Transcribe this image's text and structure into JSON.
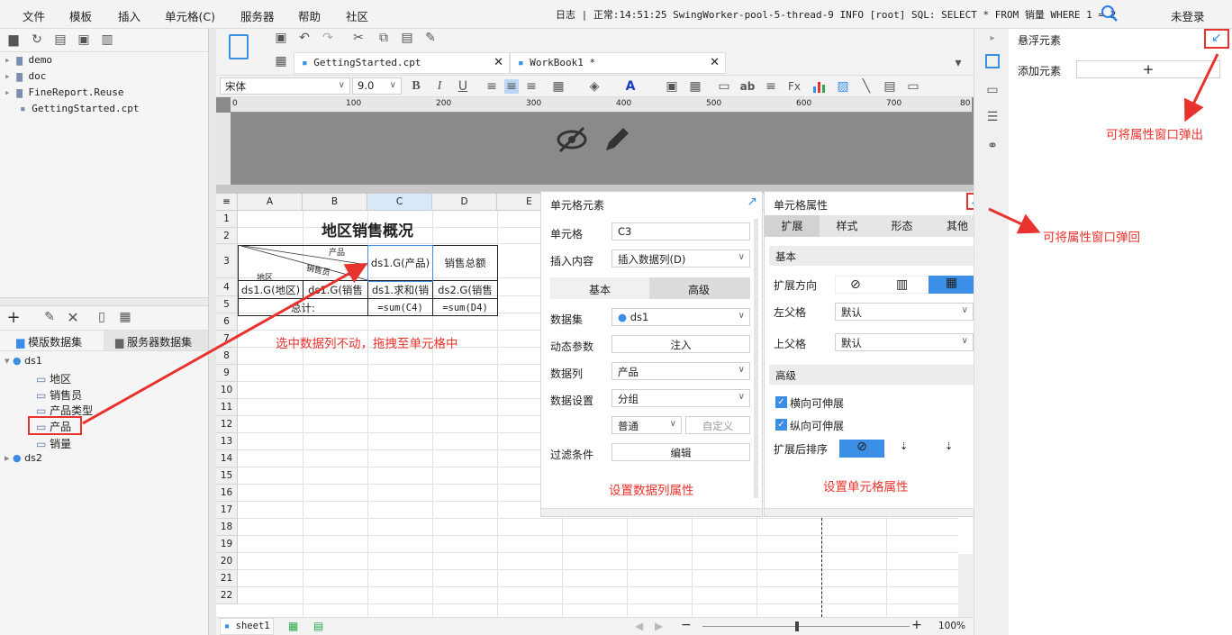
{
  "menu": [
    "文件",
    "模板",
    "插入",
    "单元格(C)",
    "服务器",
    "帮助",
    "社区"
  ],
  "log_text": "日志 | 正常:14:51:25 SwingWorker-pool-5-thread-9 INFO [root] SQL: SELECT * FROM 销量 WHERE 1 = 2",
  "login": "未登录",
  "file_tree": [
    "demo",
    "doc",
    "FineReport.Reuse",
    "GettingStarted.cpt"
  ],
  "dataset_tabs": {
    "template": "模版数据集",
    "server": "服务器数据集"
  },
  "datasets": {
    "ds1": "ds1",
    "ds1_fields": [
      "地区",
      "销售员",
      "产品类型",
      "产品",
      "销量"
    ],
    "ds2": "ds2"
  },
  "tabs": {
    "file1": "GettingStarted.cpt",
    "file2": "WorkBook1 *"
  },
  "format": {
    "font": "宋体",
    "size": "9.0"
  },
  "ruler_ticks": [
    "0",
    "100",
    "200",
    "300",
    "400",
    "500",
    "600",
    "700",
    "80"
  ],
  "columns": [
    "A",
    "B",
    "C",
    "D",
    "E"
  ],
  "rows": [
    "1",
    "2",
    "3",
    "4",
    "5",
    "6",
    "7",
    "8",
    "9",
    "10",
    "11",
    "12",
    "13",
    "14",
    "15",
    "16",
    "17",
    "18",
    "19",
    "20",
    "21",
    "22"
  ],
  "report": {
    "title": "地区销售概况",
    "diag_top": "产品",
    "diag_mid": "销售员",
    "diag_bottom": "地区",
    "c3": "ds1.G(产品)",
    "d3": "销售总额",
    "a4": "ds1.G(地区)",
    "b4": "ds1.G(销售",
    "c4": "ds1.求和(销",
    "d4": "ds2.G(销售",
    "a5": "总计:",
    "c5": "=sum(C4)",
    "d5": "=sum(D4)"
  },
  "annotations": {
    "drag": "选中数据列不动，拖拽至单元格中",
    "dataset_prop": "设置数据列属性",
    "cell_prop": "设置单元格属性",
    "popout": "可将属性窗口弹出",
    "popback": "可将属性窗口弹回"
  },
  "cell_element": {
    "title": "单元格元素",
    "cell_label": "单元格",
    "cell_value": "C3",
    "insert_label": "插入内容",
    "insert_value": "插入数据列(D)",
    "tab_basic": "基本",
    "tab_advanced": "高级",
    "dataset_label": "数据集",
    "dataset_value": "ds1",
    "param_label": "动态参数",
    "param_btn": "注入",
    "column_label": "数据列",
    "column_value": "产品",
    "setting_label": "数据设置",
    "setting_value": "分组",
    "mode_value": "普通",
    "custom_btn": "自定义",
    "filter_label": "过滤条件",
    "filter_btn": "编辑"
  },
  "cell_prop": {
    "title": "单元格属性",
    "tabs": [
      "扩展",
      "样式",
      "形态",
      "其他"
    ],
    "basic": "基本",
    "expand_dir": "扩展方向",
    "left_parent": "左父格",
    "left_value": "默认",
    "top_parent": "上父格",
    "top_value": "默认",
    "advanced": "高级",
    "h_expand": "横向可伸展",
    "v_expand": "纵向可伸展",
    "sort": "扩展后排序"
  },
  "float": {
    "title": "悬浮元素",
    "add": "添加元素"
  },
  "sheet": "sheet1",
  "zoom": "100%"
}
